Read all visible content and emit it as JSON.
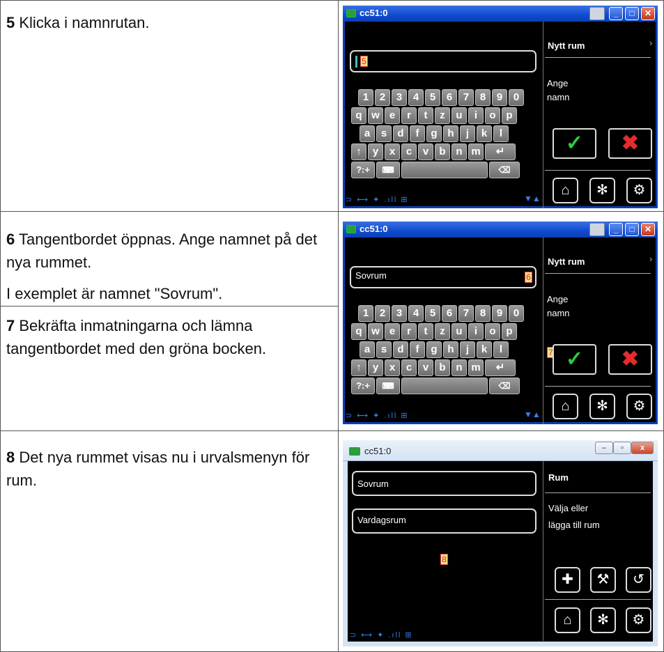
{
  "rows": [
    {
      "step": "5",
      "text": "Klicka i namnrutan."
    },
    {
      "step": "6",
      "text": "Tangentbordet öppnas. Ange namnet på det nya rummet.",
      "extra": "I exemplet är namnet \"Sovrum\"."
    },
    {
      "step": "7",
      "text": "Bekräfta inmatningarna och lämna tangentbordet med den gröna bocken."
    },
    {
      "step": "8",
      "text": "Det nya rummet visas nu i urvalsmenyn för rum."
    }
  ],
  "window": {
    "title": "cc51:0"
  },
  "screen1": {
    "heading": "Nytt rum",
    "hint1": "Ange",
    "hint2": "namn",
    "field_value": "",
    "marker": "5"
  },
  "screen2": {
    "heading": "Nytt rum",
    "hint1": "Ange",
    "hint2": "namn",
    "field_value": "Sovrum",
    "marker_field": "6",
    "marker_ok": "7"
  },
  "screen3": {
    "heading": "Rum",
    "hint1": "Välja eller",
    "hint2": "lägga till rum",
    "rooms": [
      "Sovrum",
      "Vardagsrum"
    ],
    "marker": "8"
  },
  "keyboard": {
    "row1": [
      "1",
      "2",
      "3",
      "4",
      "5",
      "6",
      "7",
      "8",
      "9",
      "0"
    ],
    "row2": [
      "q",
      "w",
      "e",
      "r",
      "t",
      "z",
      "u",
      "i",
      "o",
      "p"
    ],
    "row3": [
      "a",
      "s",
      "d",
      "f",
      "g",
      "h",
      "j",
      "k",
      "l"
    ],
    "row4": [
      "y",
      "x",
      "c",
      "v",
      "b",
      "n",
      "m"
    ],
    "special": "?:+"
  },
  "colors": {
    "check": "#2ecc40",
    "cross": "#e52b2b",
    "xp_title": "#0f4bd0"
  }
}
